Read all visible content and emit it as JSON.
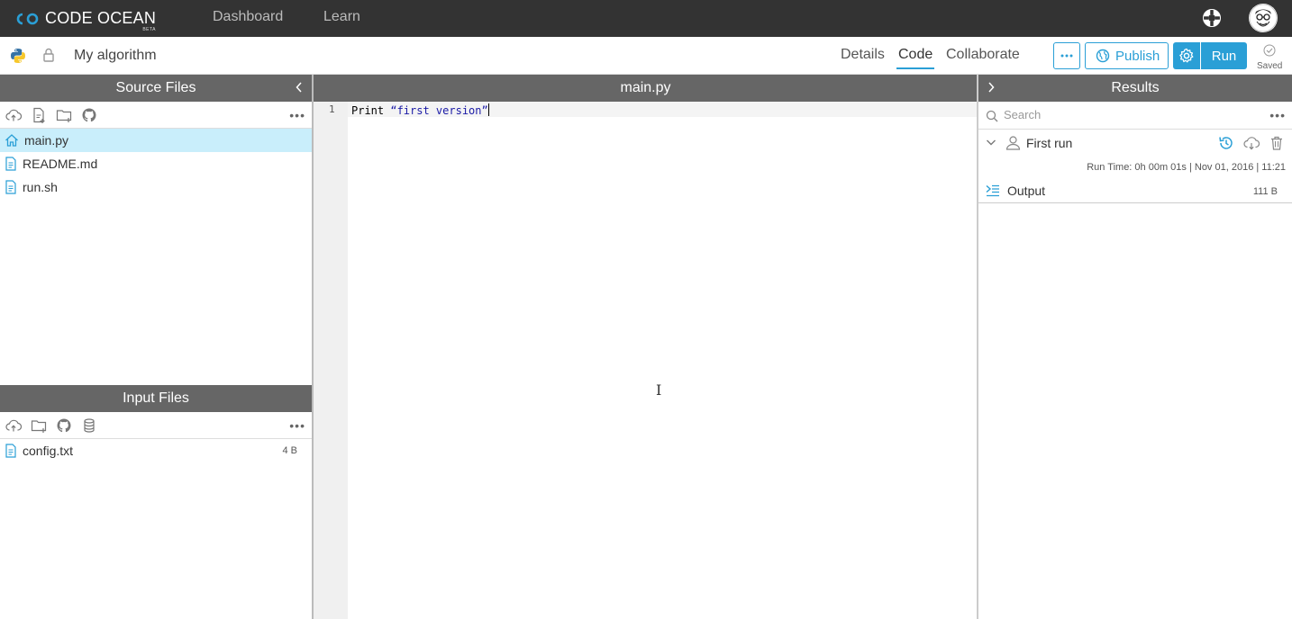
{
  "app": {
    "logo_text": "CODE OCEAN",
    "logo_badge": "BETA"
  },
  "nav": {
    "dashboard": "Dashboard",
    "learn": "Learn"
  },
  "toolbar": {
    "capsule_title": "My algorithm",
    "tabs": [
      "Details",
      "Code",
      "Collaborate"
    ],
    "active_tab": "Code",
    "more_label": "•••",
    "publish_label": "Publish",
    "run_label": "Run",
    "saved_label": "Saved"
  },
  "source_files": {
    "title": "Source Files",
    "files": [
      {
        "name": "main.py",
        "icon": "home-icon",
        "active": true
      },
      {
        "name": "README.md",
        "icon": "file-icon",
        "active": false
      },
      {
        "name": "run.sh",
        "icon": "file-icon",
        "active": false
      }
    ]
  },
  "input_files": {
    "title": "Input Files",
    "files": [
      {
        "name": "config.txt",
        "size": "4 B",
        "icon": "file-icon"
      }
    ]
  },
  "editor": {
    "filename": "main.py",
    "line_number": "1",
    "code_keyword": "Print ",
    "code_string": "“first version”"
  },
  "results": {
    "title": "Results",
    "search_placeholder": "Search",
    "run_name": "First run",
    "run_meta": "Run Time: 0h 00m 01s | Nov 01, 2016 | 11:21",
    "output_label": "Output",
    "output_size": "111 B"
  },
  "colors": {
    "accent": "#2a9fd6",
    "nav_bg": "#333333",
    "panel_header": "#666666",
    "active_file": "#c9eefb"
  }
}
